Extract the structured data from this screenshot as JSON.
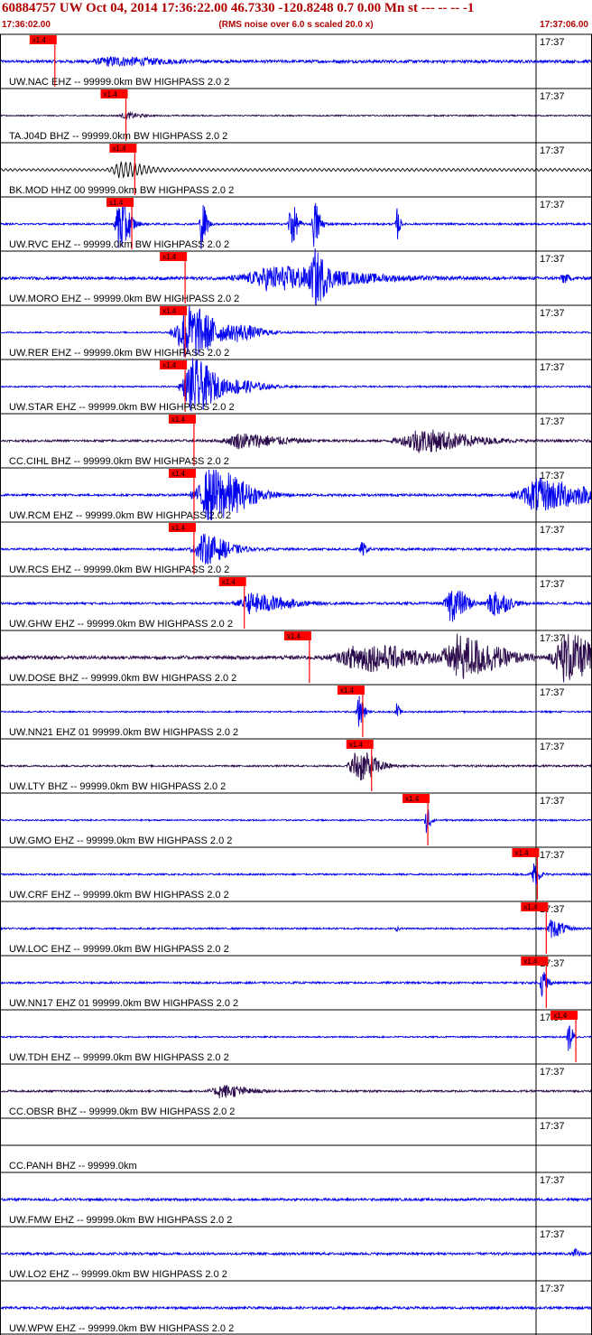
{
  "header": {
    "title": "60884757 UW Oct 04, 2014 17:36:22.00   46.7330 -120.8248  0.7 0.00 Mn st --- -- --  -1",
    "start_time": "17:36:02.00",
    "rms_note": "(RMS noise over 6.0 s scaled 20.0 x)",
    "end_time": "17:37:06.00"
  },
  "colors": {
    "header_text": "#b00000",
    "trace_blue": "#0000ee",
    "trace_dark": "#2a0a4a",
    "trace_black": "#000000",
    "pick": "#ff0000"
  },
  "chart_data": {
    "type": "line",
    "title": "60884757 UW Oct 04, 2014 17:36:22.00   46.7330 -120.8248  0.7 0.00 Mn st --- -- --  -1",
    "x_range": [
      "17:36:02.00",
      "17:37:06.00"
    ],
    "minute_tick_label": "17:37",
    "pick_label": "x1.4",
    "series": [
      {
        "name": "UW.NAC EHZ -- 99999.0km BW  HIGHPASS  2.0  2",
        "color": "#0000ee",
        "pick": 0.05,
        "amp": 0.18,
        "bursts": [
          [
            0.18,
            0.1,
            0.5
          ]
        ]
      },
      {
        "name": "TA.J04D BHZ -- 99999.0km BW  HIGHPASS  2.0  2",
        "color": "#2a0a4a",
        "pick": 0.17,
        "amp": 0.08,
        "bursts": [
          [
            0.21,
            0.03,
            0.35
          ]
        ]
      },
      {
        "name": "BK.MOD HHZ 00 99999.0km BW  HIGHPASS  2.0  2",
        "color": "#000000",
        "pick": 0.185,
        "amp": 0.18,
        "wavy": true,
        "bursts": [
          [
            0.2,
            0.05,
            0.9
          ]
        ]
      },
      {
        "name": "UW.RVC EHZ -- 99999.0km BW  HIGHPASS  2.0  2",
        "color": "#0000ee",
        "pick": 0.18,
        "amp": 0.12,
        "clip": true,
        "bursts": [
          [
            0.2,
            0.02,
            4
          ],
          [
            0.34,
            0.01,
            3
          ],
          [
            0.49,
            0.012,
            3
          ],
          [
            0.53,
            0.012,
            3
          ],
          [
            0.67,
            0.006,
            2
          ]
        ]
      },
      {
        "name": "UW.MORO EHZ -- 99999.0km BW  HIGHPASS  2.0  2",
        "color": "#0000ee",
        "pick": 0.27,
        "amp": 0.2,
        "bursts": [
          [
            0.45,
            0.16,
            1.4
          ],
          [
            0.53,
            0.02,
            2.5
          ],
          [
            0.95,
            0.01,
            0.6
          ]
        ]
      },
      {
        "name": "UW.RER EHZ -- 99999.0km BW  HIGHPASS  2.0  2",
        "color": "#0000ee",
        "pick": 0.27,
        "amp": 0.1,
        "bursts": [
          [
            0.31,
            0.06,
            3.5
          ],
          [
            0.4,
            0.05,
            0.8
          ]
        ]
      },
      {
        "name": "UW.STAR EHZ -- 99999.0km BW  HIGHPASS  2.0  2",
        "color": "#0000ee",
        "pick": 0.27,
        "amp": 0.1,
        "bursts": [
          [
            0.32,
            0.05,
            3.5
          ],
          [
            0.4,
            0.05,
            0.7
          ]
        ]
      },
      {
        "name": "CC.CIHL BHZ -- 99999.0km BW  HIGHPASS  2.0  2",
        "color": "#2a0a4a",
        "pick": 0.285,
        "amp": 0.15,
        "bursts": [
          [
            0.4,
            0.08,
            0.9
          ],
          [
            0.7,
            0.1,
            1.4
          ]
        ]
      },
      {
        "name": "UW.RCM EHZ -- 99999.0km BW  HIGHPASS  2.0  2",
        "color": "#0000ee",
        "pick": 0.285,
        "amp": 0.15,
        "clip": true,
        "bursts": [
          [
            0.35,
            0.07,
            3.5
          ],
          [
            0.9,
            0.1,
            2.0
          ]
        ]
      },
      {
        "name": "UW.RCS EHZ -- 99999.0km BW  HIGHPASS  2.0  2",
        "color": "#0000ee",
        "pick": 0.285,
        "amp": 0.15,
        "bursts": [
          [
            0.34,
            0.05,
            1.8
          ],
          [
            0.61,
            0.01,
            0.8
          ]
        ]
      },
      {
        "name": "UW.GHW EHZ -- 99999.0km BW  HIGHPASS  2.0  2",
        "color": "#0000ee",
        "pick": 0.37,
        "amp": 0.15,
        "bursts": [
          [
            0.42,
            0.07,
            1.2
          ],
          [
            0.76,
            0.03,
            2.2
          ],
          [
            0.83,
            0.03,
            1.8
          ]
        ]
      },
      {
        "name": "UW.DOSE BHZ -- 99999.0km BW  HIGHPASS  2.0  2",
        "color": "#2a0a4a",
        "pick": 0.48,
        "amp": 0.25,
        "bursts": [
          [
            0.6,
            0.12,
            1.6
          ],
          [
            0.77,
            0.08,
            2.5
          ],
          [
            0.95,
            0.06,
            3.0
          ]
        ]
      },
      {
        "name": "UW.NN21 EHZ 01 99999.0km BW  HIGHPASS  2.0  2",
        "color": "#0000ee",
        "pick": 0.57,
        "amp": 0.1,
        "bursts": [
          [
            0.605,
            0.01,
            2.2
          ],
          [
            0.67,
            0.005,
            1.0
          ]
        ]
      },
      {
        "name": "UW.LTY BHZ -- 99999.0km BW  HIGHPASS  2.0  2",
        "color": "#2a0a4a",
        "pick": 0.585,
        "amp": 0.12,
        "bursts": [
          [
            0.6,
            0.04,
            2.0
          ]
        ]
      },
      {
        "name": "UW.GMO EHZ -- 99999.0km BW  HIGHPASS  2.0  2",
        "color": "#0000ee",
        "pick": 0.68,
        "amp": 0.1,
        "bursts": [
          [
            0.72,
            0.008,
            2.0
          ]
        ]
      },
      {
        "name": "UW.CRF EHZ -- 99999.0km BW  HIGHPASS  2.0  2",
        "color": "#0000ee",
        "pick": 0.865,
        "amp": 0.12,
        "bursts": [
          [
            0.9,
            0.012,
            1.5
          ]
        ]
      },
      {
        "name": "UW.LOC EHZ -- 99999.0km BW  HIGHPASS  2.0  2",
        "color": "#0000ee",
        "pick": 0.88,
        "amp": 0.12,
        "bursts": [
          [
            0.93,
            0.025,
            1.1
          ],
          [
            0.67,
            0.004,
            0.6
          ]
        ]
      },
      {
        "name": "UW.NN17 EHZ 01 99999.0km BW  HIGHPASS  2.0  2",
        "color": "#0000ee",
        "pick": 0.88,
        "amp": 0.14,
        "bursts": [
          [
            0.915,
            0.01,
            2.0
          ]
        ]
      },
      {
        "name": "UW.TDH EHZ -- 99999.0km BW  HIGHPASS  2.0  2",
        "color": "#0000ee",
        "pick": 0.93,
        "amp": 0.1,
        "bursts": [
          [
            0.96,
            0.008,
            2.0
          ]
        ]
      },
      {
        "name": "CC.OBSR BHZ -- 99999.0km BW  HIGHPASS  2.0  2",
        "color": "#2a0a4a",
        "pick": null,
        "amp": 0.12,
        "bursts": [
          [
            0.37,
            0.05,
            0.8
          ]
        ]
      },
      {
        "name": "CC.PANH BHZ -- 99999.0km",
        "color": "#000000",
        "pick": null,
        "amp": 0,
        "flat": true,
        "bursts": []
      },
      {
        "name": "UW.FMW EHZ -- 99999.0km BW  HIGHPASS  2.0  2",
        "color": "#0000ee",
        "pick": null,
        "amp": 0.15,
        "bursts": []
      },
      {
        "name": "UW.LO2 EHZ -- 99999.0km BW  HIGHPASS  2.0  2",
        "color": "#0000ee",
        "pick": null,
        "amp": 0.15,
        "bursts": [
          [
            0.97,
            0.01,
            0.5
          ]
        ]
      },
      {
        "name": "UW.WPW EHZ -- 99999.0km BW  HIGHPASS  2.0  2",
        "color": "#0000ee",
        "pick": null,
        "amp": 0.15,
        "bursts": []
      }
    ]
  }
}
